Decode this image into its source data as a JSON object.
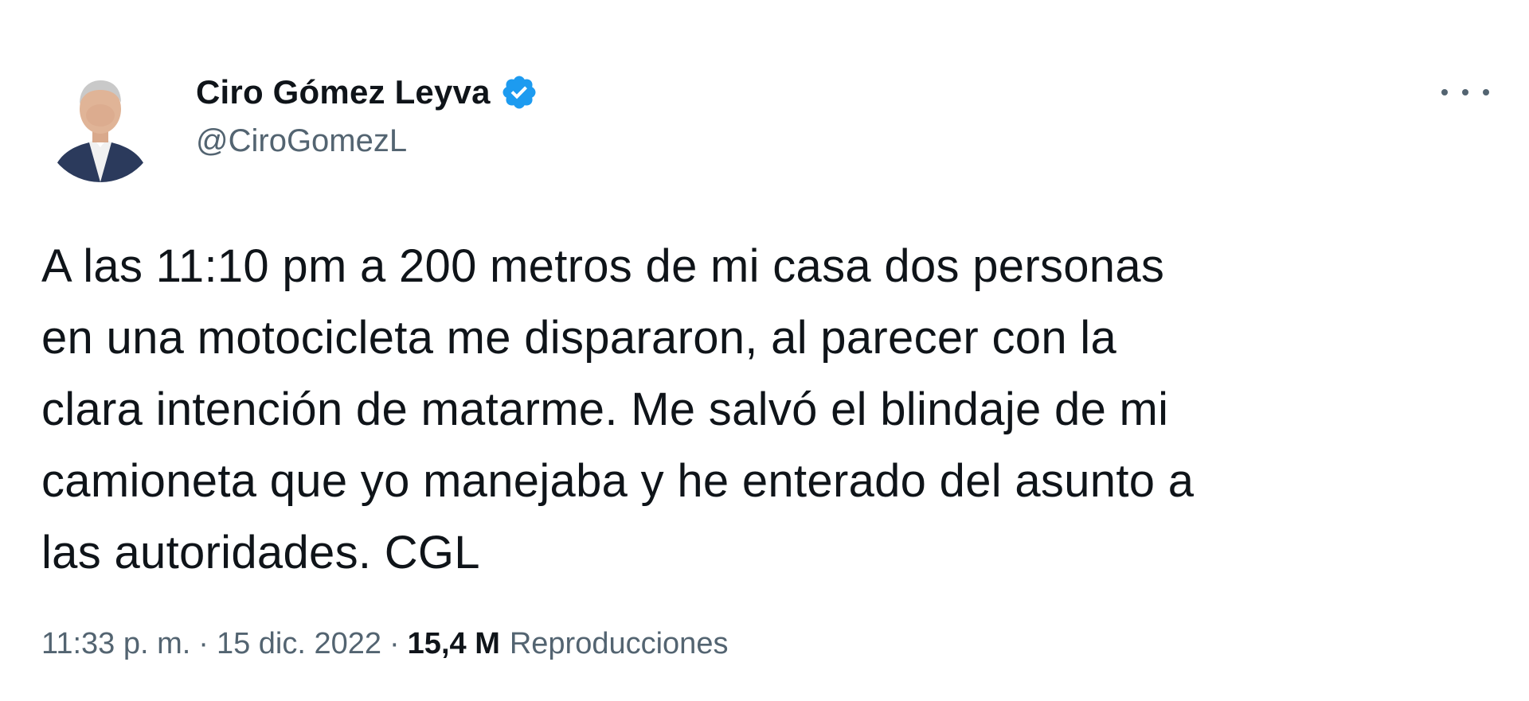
{
  "author": {
    "display_name": "Ciro Gómez Leyva",
    "handle": "@CiroGomezL",
    "verified": true,
    "verified_icon": "verified-badge-icon",
    "avatar": "profile-photo"
  },
  "menu": {
    "icon": "more-options-icon"
  },
  "tweet": {
    "text": "A las 11:10 pm a 200 metros de mi casa dos personas\nen una motocicleta me dispararon, al parecer con la\nclara intención de matarme. Me salvó el blindaje de mi\ncamioneta que yo manejaba y he enterado del asunto a\nlas autoridades. CGL"
  },
  "meta": {
    "time": "11:33 p. m.",
    "separator": "·",
    "date": "15 dic. 2022",
    "views_count": "15,4 M",
    "views_label": "Reproducciones"
  },
  "colors": {
    "text_primary": "#0f1419",
    "text_secondary": "#536471",
    "verified_blue": "#1d9bf0",
    "background": "#ffffff"
  }
}
